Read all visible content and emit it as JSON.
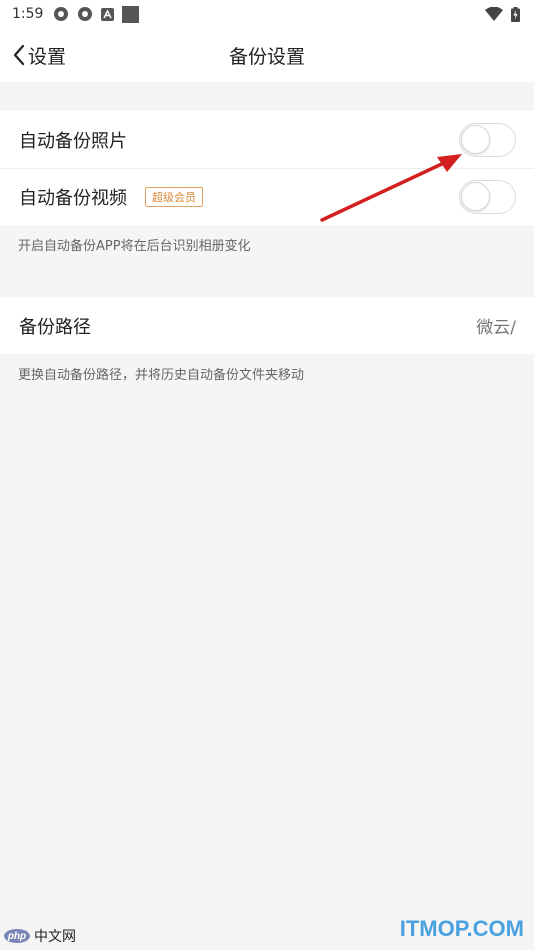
{
  "status_bar": {
    "time": "1:59"
  },
  "nav": {
    "back_label": "设置",
    "title": "备份设置"
  },
  "auto_backup": {
    "photos": {
      "label": "自动备份照片",
      "enabled": false
    },
    "videos": {
      "label": "自动备份视频",
      "badge": "超级会员",
      "enabled": false
    },
    "hint": "开启自动备份APP将在后台识别相册变化"
  },
  "backup_path": {
    "label": "备份路径",
    "value": "微云/",
    "hint": "更换自动备份路径，并将历史自动备份文件夹移动"
  },
  "watermarks": {
    "itmop": "ITMOP.COM",
    "php_logo": "php",
    "php_site": "中文网"
  },
  "colors": {
    "background": "#f5f5f5",
    "badge": "#d7893c",
    "arrow": "#d41f1f",
    "watermark": "#4aa2e0"
  }
}
